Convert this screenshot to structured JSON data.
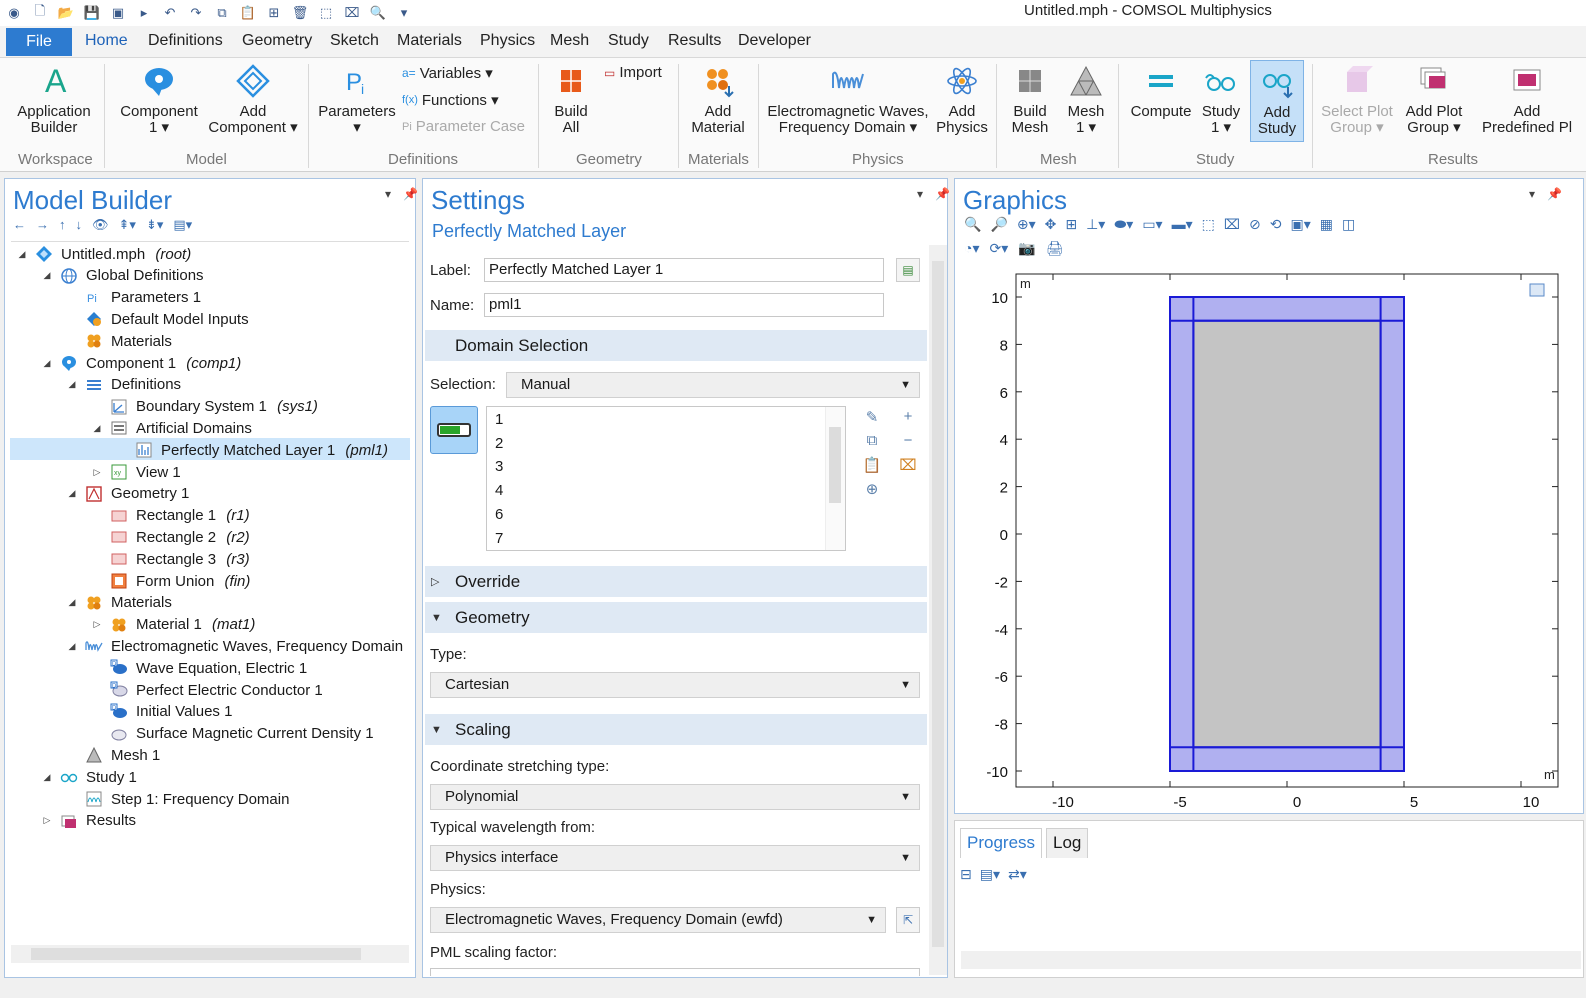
{
  "window": {
    "title": "Untitled.mph - COMSOL Multiphysics"
  },
  "menu": {
    "file": "File",
    "tabs": [
      "Home",
      "Definitions",
      "Geometry",
      "Sketch",
      "Materials",
      "Physics",
      "Mesh",
      "Study",
      "Results",
      "Developer"
    ]
  },
  "ribbon": {
    "app_builder": "Application\nBuilder",
    "component": "Component\n1 ▾",
    "add_component": "Add\nComponent ▾",
    "parameters": "Parameters\n▾",
    "variables": "Variables ▾",
    "functions": "Functions ▾",
    "parameter_case": "Parameter Case",
    "build_all": "Build\nAll",
    "import": "Import",
    "add_material": "Add\nMaterial",
    "physics_emw": "Electromagnetic Waves,\nFrequency Domain ▾",
    "add_physics": "Add\nPhysics",
    "build_mesh": "Build\nMesh",
    "mesh": "Mesh\n1 ▾",
    "compute": "Compute",
    "study": "Study\n1 ▾",
    "add_study": "Add\nStudy",
    "select_plot_group": "Select Plot\nGroup ▾",
    "add_plot_group": "Add Plot\nGroup ▾",
    "add_predefined": "Add\nPredefined Pl",
    "groups": [
      "Workspace",
      "Model",
      "Definitions",
      "Geometry",
      "Materials",
      "Physics",
      "Mesh",
      "Study",
      "Results"
    ]
  },
  "model_builder": {
    "title": "Model Builder",
    "tree": [
      {
        "label": "Untitled.mph",
        "tag": "(root)"
      },
      {
        "label": "Global Definitions",
        "tag": ""
      },
      {
        "label": "Parameters 1",
        "tag": ""
      },
      {
        "label": "Default Model Inputs",
        "tag": ""
      },
      {
        "label": "Materials",
        "tag": ""
      },
      {
        "label": "Component 1",
        "tag": "(comp1)"
      },
      {
        "label": "Definitions",
        "tag": ""
      },
      {
        "label": "Boundary System 1",
        "tag": "(sys1)"
      },
      {
        "label": "Artificial Domains",
        "tag": ""
      },
      {
        "label": "Perfectly Matched Layer 1",
        "tag": "(pml1)"
      },
      {
        "label": "View 1",
        "tag": ""
      },
      {
        "label": "Geometry 1",
        "tag": ""
      },
      {
        "label": "Rectangle 1",
        "tag": "(r1)"
      },
      {
        "label": "Rectangle 2",
        "tag": "(r2)"
      },
      {
        "label": "Rectangle 3",
        "tag": "(r3)"
      },
      {
        "label": "Form Union",
        "tag": "(fin)"
      },
      {
        "label": "Materials",
        "tag": ""
      },
      {
        "label": "Material 1",
        "tag": "(mat1)"
      },
      {
        "label": "Electromagnetic Waves, Frequency Domain",
        "tag": ""
      },
      {
        "label": "Wave Equation, Electric 1",
        "tag": ""
      },
      {
        "label": "Perfect Electric Conductor 1",
        "tag": ""
      },
      {
        "label": "Initial Values 1",
        "tag": ""
      },
      {
        "label": "Surface Magnetic Current Density 1",
        "tag": ""
      },
      {
        "label": "Mesh 1",
        "tag": ""
      },
      {
        "label": "Study 1",
        "tag": ""
      },
      {
        "label": "Step 1: Frequency Domain",
        "tag": ""
      },
      {
        "label": "Results",
        "tag": ""
      }
    ]
  },
  "settings": {
    "title": "Settings",
    "subtitle": "Perfectly Matched Layer",
    "label_label": "Label:",
    "label_value": "Perfectly Matched Layer 1",
    "name_label": "Name:",
    "name_value": "pml1",
    "domain_selection": "Domain Selection",
    "selection_label": "Selection:",
    "selection_value": "Manual",
    "domains": [
      "1",
      "2",
      "3",
      "4",
      "6",
      "7"
    ],
    "override": "Override",
    "geometry": "Geometry",
    "type_label": "Type:",
    "type_value": "Cartesian",
    "scaling": "Scaling",
    "coord_label": "Coordinate stretching type:",
    "coord_value": "Polynomial",
    "wavelength_label": "Typical wavelength from:",
    "wavelength_value": "Physics interface",
    "physics_label": "Physics:",
    "physics_value": "Electromagnetic Waves, Frequency Domain (ewfd)",
    "pml_factor_label": "PML scaling factor:"
  },
  "graphics": {
    "title": "Graphics",
    "unit": "m",
    "y_ticks": [
      "10",
      "8",
      "6",
      "4",
      "2",
      "0",
      "-2",
      "-4",
      "-6",
      "-8",
      "-10"
    ],
    "x_ticks": [
      "-10",
      "-5",
      "0",
      "5",
      "10"
    ]
  },
  "progress": {
    "tabs": [
      "Progress",
      "Log"
    ]
  },
  "colors": {
    "accent": "#2e7bcf",
    "pml_fill": "#b0b0f0",
    "pml_edge": "#1a1ad6",
    "domain_fill": "#c4c4c4",
    "selection": "#cde6fb"
  }
}
